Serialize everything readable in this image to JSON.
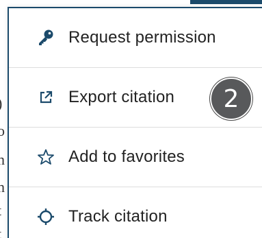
{
  "menu": {
    "items": [
      {
        "label": "Request permission",
        "icon": "key-icon"
      },
      {
        "label": "Export citation",
        "icon": "external-link-icon"
      },
      {
        "label": "Add to favorites",
        "icon": "star-outline-icon"
      },
      {
        "label": "Track citation",
        "icon": "crosshair-icon"
      }
    ]
  },
  "badge": {
    "number": "2"
  },
  "background": {
    "chars": [
      ")",
      "o",
      "n",
      "n",
      "t",
      "t"
    ]
  },
  "colors": {
    "accent": "#1b4a6b",
    "icon": "#1b4a6b",
    "text": "#222222",
    "badge": "#58595b"
  }
}
